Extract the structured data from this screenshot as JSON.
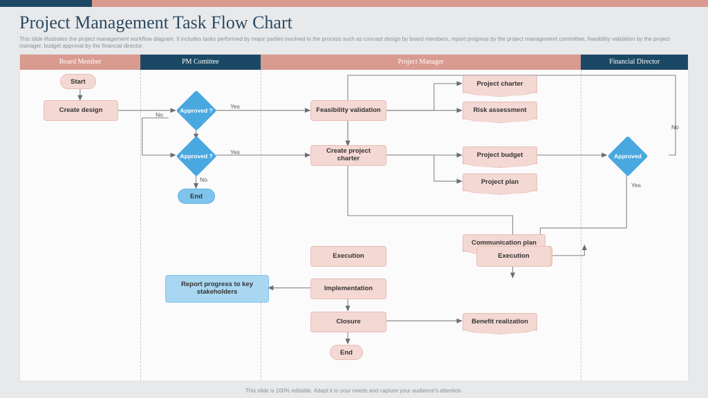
{
  "title": "Project Management Task Flow Chart",
  "subtitle": "This slide illustrates the project management workflow diagram. It includes tasks performed by major parties involved in the process such as concept design by board members, report progress by the project management committee, feasibility validation by the project manager, budget approval by the financial director.",
  "footer": "This slide is 100% editable. Adapt it to your needs and capture your audience's attention.",
  "lanes": {
    "board_member": "Board Member",
    "pm_committee": "PM Comittee",
    "project_manager": "Project Manager",
    "financial_director": "Financial Director"
  },
  "nodes": {
    "start": "Start",
    "create_design": "Create design",
    "approved1": "Approved ?",
    "approved2": "Approved ?",
    "end1": "End",
    "feasibility": "Feasibility validation",
    "create_charter": "Create project charter",
    "execution": "Execution",
    "implementation": "Implementation",
    "closure": "Closure",
    "end2": "End",
    "project_charter": "Project charter",
    "risk_assessment": "Risk assessment",
    "project_budget": "Project budget",
    "project_plan": "Project plan",
    "comm_plan": "Communication plan",
    "benefit": "Benefit realization",
    "report_progress": "Report progress to key stakeholders",
    "approved3": "Approved"
  },
  "edges": {
    "yes": "Yes",
    "no": "No"
  },
  "chart_data": {
    "type": "flowchart",
    "swimlanes": [
      "Board Member",
      "PM Comittee",
      "Project Manager",
      "Financial Director"
    ],
    "nodes": [
      {
        "id": "start",
        "lane": "Board Member",
        "type": "terminator",
        "label": "Start"
      },
      {
        "id": "create_design",
        "lane": "Board Member",
        "type": "process",
        "label": "Create design"
      },
      {
        "id": "approved1",
        "lane": "PM Comittee",
        "type": "decision",
        "label": "Approved ?"
      },
      {
        "id": "approved2",
        "lane": "PM Comittee",
        "type": "decision",
        "label": "Approved ?"
      },
      {
        "id": "end1",
        "lane": "PM Comittee",
        "type": "terminator",
        "label": "End"
      },
      {
        "id": "report_progress",
        "lane": "PM Comittee",
        "type": "process",
        "label": "Report progress to key stakeholders"
      },
      {
        "id": "feasibility",
        "lane": "Project Manager",
        "type": "process",
        "label": "Feasibility validation"
      },
      {
        "id": "create_charter",
        "lane": "Project Manager",
        "type": "process",
        "label": "Create project charter"
      },
      {
        "id": "execution",
        "lane": "Project Manager",
        "type": "process",
        "label": "Execution"
      },
      {
        "id": "implementation",
        "lane": "Project Manager",
        "type": "process",
        "label": "Implementation"
      },
      {
        "id": "closure",
        "lane": "Project Manager",
        "type": "process",
        "label": "Closure"
      },
      {
        "id": "end2",
        "lane": "Project Manager",
        "type": "terminator",
        "label": "End"
      },
      {
        "id": "project_charter",
        "lane": "Project Manager",
        "type": "document",
        "label": "Project charter"
      },
      {
        "id": "risk_assessment",
        "lane": "Project Manager",
        "type": "document",
        "label": "Risk assessment"
      },
      {
        "id": "project_budget",
        "lane": "Project Manager",
        "type": "document",
        "label": "Project budget"
      },
      {
        "id": "project_plan",
        "lane": "Project Manager",
        "type": "document",
        "label": "Project plan"
      },
      {
        "id": "comm_plan",
        "lane": "Project Manager",
        "type": "document",
        "label": "Communication plan"
      },
      {
        "id": "benefit",
        "lane": "Project Manager",
        "type": "document",
        "label": "Benefit realization"
      },
      {
        "id": "approved3",
        "lane": "Financial Director",
        "type": "decision",
        "label": "Approved"
      }
    ],
    "edges": [
      {
        "from": "start",
        "to": "create_design"
      },
      {
        "from": "create_design",
        "to": "approved1"
      },
      {
        "from": "approved1",
        "to": "feasibility",
        "label": "Yes"
      },
      {
        "from": "approved1",
        "to": "approved2",
        "label": "No"
      },
      {
        "from": "approved2",
        "to": "create_charter",
        "label": "Yes"
      },
      {
        "from": "approved2",
        "to": "end1",
        "label": "No"
      },
      {
        "from": "feasibility",
        "to": "project_charter"
      },
      {
        "from": "feasibility",
        "to": "risk_assessment"
      },
      {
        "from": "feasibility",
        "to": "create_charter"
      },
      {
        "from": "create_charter",
        "to": "project_budget"
      },
      {
        "from": "create_charter",
        "to": "project_plan"
      },
      {
        "from": "project_budget",
        "to": "approved3"
      },
      {
        "from": "approved3",
        "to": "execution",
        "label": "Yes"
      },
      {
        "from": "approved3",
        "to": "create_charter",
        "label": "No"
      },
      {
        "from": "execution",
        "to": "comm_plan"
      },
      {
        "from": "execution",
        "to": "implementation"
      },
      {
        "from": "implementation",
        "to": "closure"
      },
      {
        "from": "implementation",
        "to": "report_progress"
      },
      {
        "from": "closure",
        "to": "benefit"
      },
      {
        "from": "closure",
        "to": "end2"
      }
    ]
  }
}
